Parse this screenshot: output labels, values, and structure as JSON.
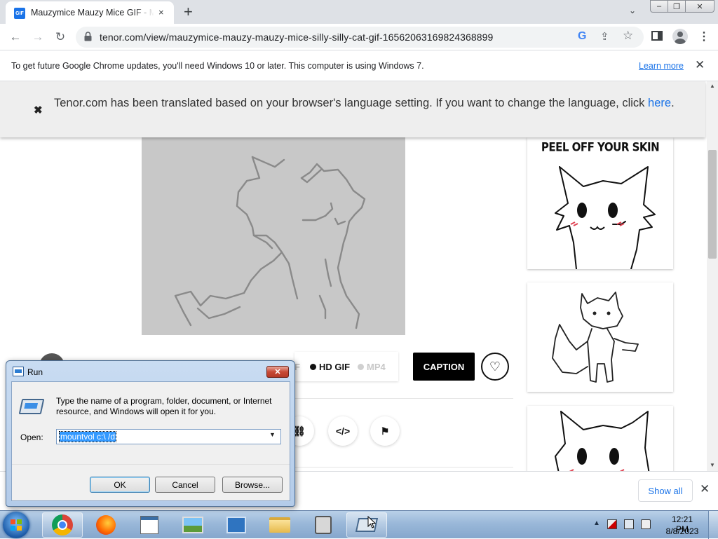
{
  "browser": {
    "tab_title": "Mauzymice Mauzy Mice GIF - Mauzymice Mauzy Mice Silly - Discover & Share GIFs",
    "tab_favicon": "GIF",
    "tab_close": "×",
    "new_tab": "+",
    "tab_search": "⌄",
    "window_controls": {
      "minimize": "‒",
      "maximize": "❐",
      "close": "✕"
    },
    "nav": {
      "back": "←",
      "forward": "→",
      "reload": "↻"
    },
    "url": "tenor.com/view/mauzymice-mauzy-mauzy-mice-silly-silly-cat-gif-16562063169824368899",
    "omnibox_icons": {
      "google": "G",
      "share": "⇪",
      "bookmark": "☆"
    },
    "menu": "⋮"
  },
  "infobar": {
    "text": "To get future Google Chrome updates, you'll need Windows 10 or later. This computer is using Windows 7.",
    "link": "Learn more",
    "close": "✕"
  },
  "page": {
    "translate_close": "✖",
    "translate_text": "Tenor.com has been translated based on your browser's language setting. If you want to change the language, click ",
    "translate_link": "here",
    "translate_end": ".",
    "formats": {
      "gif": "F",
      "hd_gif": "HD GIF",
      "mp4": "MP4"
    },
    "caption_button": "CAPTION",
    "heart": "♡",
    "share_buttons": {
      "link": "⛓",
      "embed": "</>",
      "flag": "⚑"
    },
    "thumb_1_caption": "PEEL OFF YOUR SKIN",
    "scroll_up": "▲",
    "scroll_down": "▼"
  },
  "downloadbar": {
    "show_all": "Show all",
    "close": "✕"
  },
  "run_dialog": {
    "title": "Run",
    "close": "✕",
    "description": "Type the name of a program, folder, document, or Internet resource, and Windows will open it for you.",
    "open_label": "Open:",
    "open_value": "mountvol c:\\ /d",
    "dropdown": "▼",
    "ok": "OK",
    "cancel": "Cancel",
    "browse": "Browse..."
  },
  "taskbar": {
    "tray_chevron": "▲",
    "time": "12:21 PM",
    "date": "8/8/2023"
  }
}
